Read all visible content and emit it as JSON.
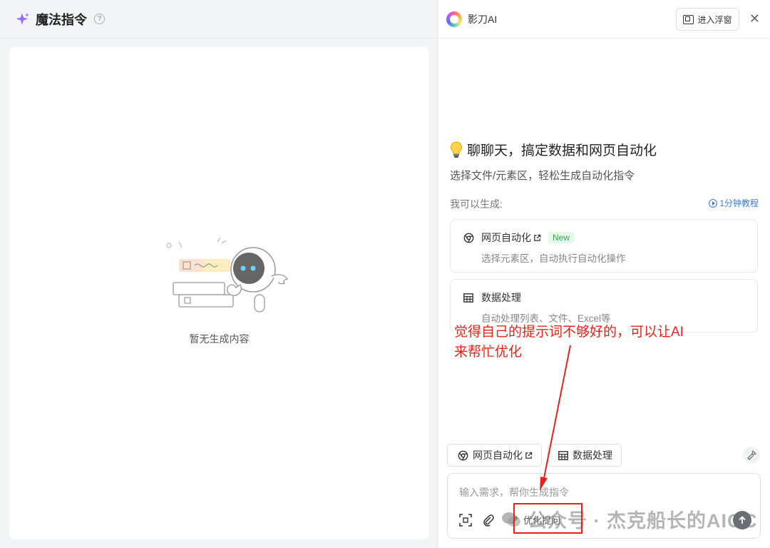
{
  "left": {
    "title": "魔法指令",
    "help_icon": "question-circle-icon",
    "empty_text": "暂无生成内容"
  },
  "right": {
    "app_title": "影刀AI",
    "float_button_label": "进入浮窗",
    "close_label": "✕",
    "headline": "聊聊天，搞定数据和网页自动化",
    "subline": "选择文件/元素区，轻松生成自动化指令",
    "can_generate_label": "我可以生成:",
    "tutorial_label": "1分钟教程",
    "cards": [
      {
        "title": "网页自动化",
        "badge": "New",
        "desc": "选择元素区，自动执行自动化操作"
      },
      {
        "title": "数据处理",
        "desc": "自动处理列表、文件、Excel等"
      }
    ],
    "annotation_line1": "觉得自己的提示词不够好的，可以让AI",
    "annotation_line2": "来帮忙优化",
    "chips": [
      {
        "label": "网页自动化"
      },
      {
        "label": "数据处理"
      }
    ],
    "input": {
      "placeholder": "输入需求，帮你生成指令",
      "optimize_label": "优化提问"
    },
    "watermark": "公众号 · 杰克船长的AIGC"
  },
  "colors": {
    "accent_red": "#e1251b",
    "link_blue": "#3a7bd5",
    "new_badge_green": "#34a853"
  }
}
